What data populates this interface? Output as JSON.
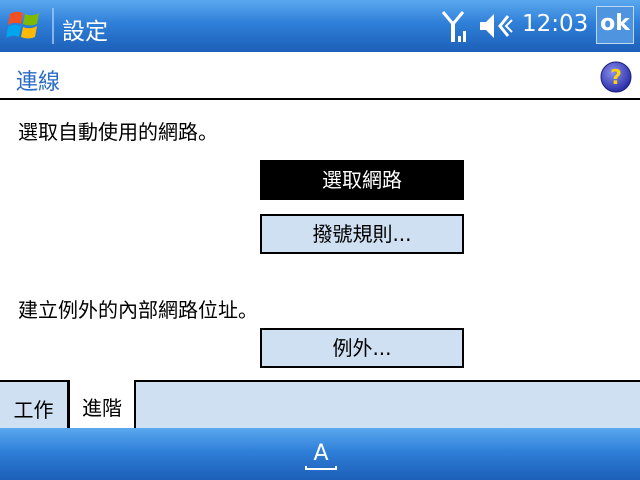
{
  "titlebar": {
    "title": "設定",
    "time": "12:03",
    "ok_label": "ok",
    "icons": [
      "windows-start-icon",
      "signal-icon",
      "speaker-icon"
    ]
  },
  "header": {
    "title": "連線",
    "help_icon": "help-icon"
  },
  "main": {
    "network_prompt": "選取自動使用的網路。",
    "select_network_button": "選取網路",
    "dialing_rules_button": "撥號規則...",
    "exception_prompt": "建立例外的內部網路位址。",
    "exceptions_button": "例外..."
  },
  "tabs": [
    {
      "label": "工作",
      "active": false
    },
    {
      "label": "進階",
      "active": true
    }
  ],
  "menubar": {
    "ime_icon": "input-method-icon"
  },
  "colors": {
    "titlebar_blue": "#2f7fd8",
    "accent_text": "#2b6cc4",
    "button_fill": "#cfe0f2"
  }
}
